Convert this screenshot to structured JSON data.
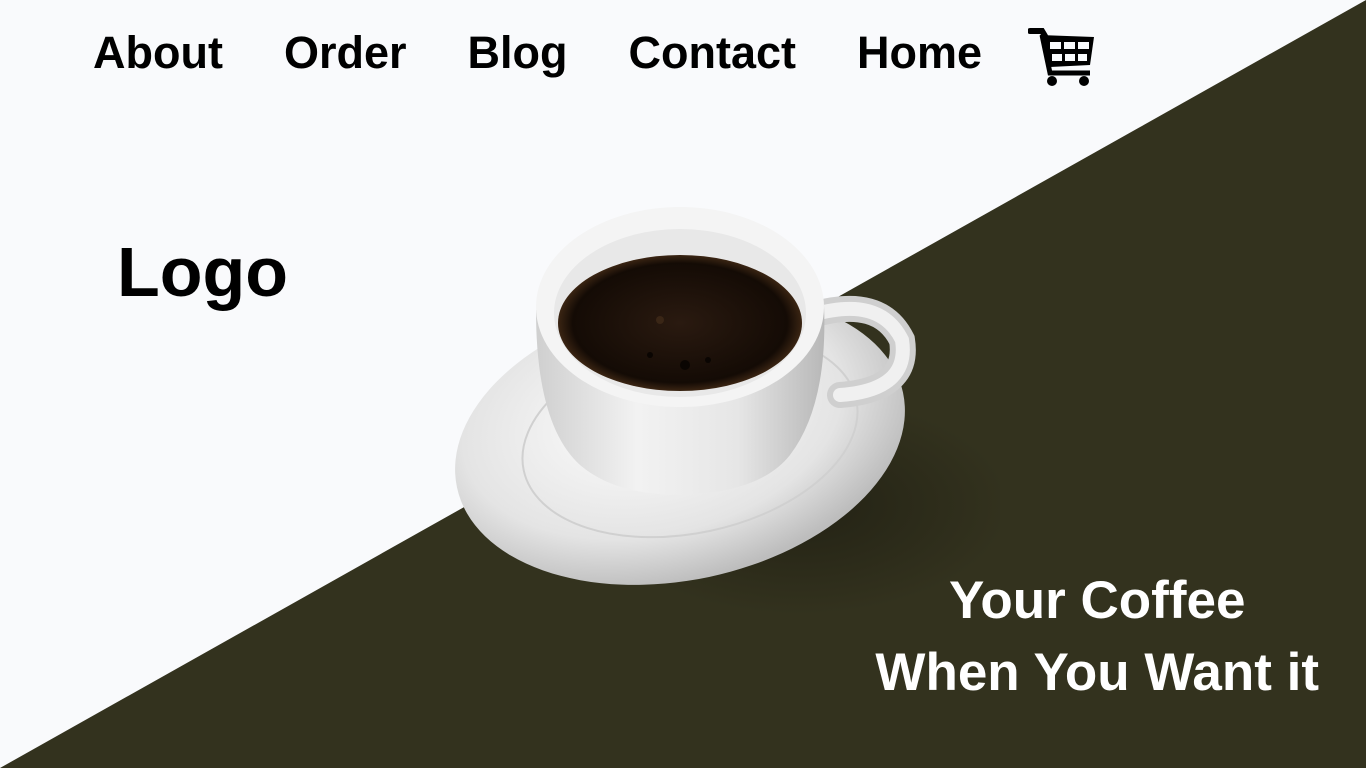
{
  "colors": {
    "background_light": "#f9fafc",
    "background_dark": "#33321e",
    "text_dark": "#000000",
    "text_light": "#ffffff"
  },
  "nav": {
    "items": [
      {
        "label": "About"
      },
      {
        "label": "Order"
      },
      {
        "label": "Blog"
      },
      {
        "label": "Contact"
      },
      {
        "label": "Home"
      }
    ],
    "cart_icon": "shopping-cart-icon"
  },
  "hero": {
    "logo_text": "Logo",
    "image": "coffee-cup-on-saucer",
    "tagline_line1": "Your Coffee",
    "tagline_line2": "When You Want it"
  }
}
